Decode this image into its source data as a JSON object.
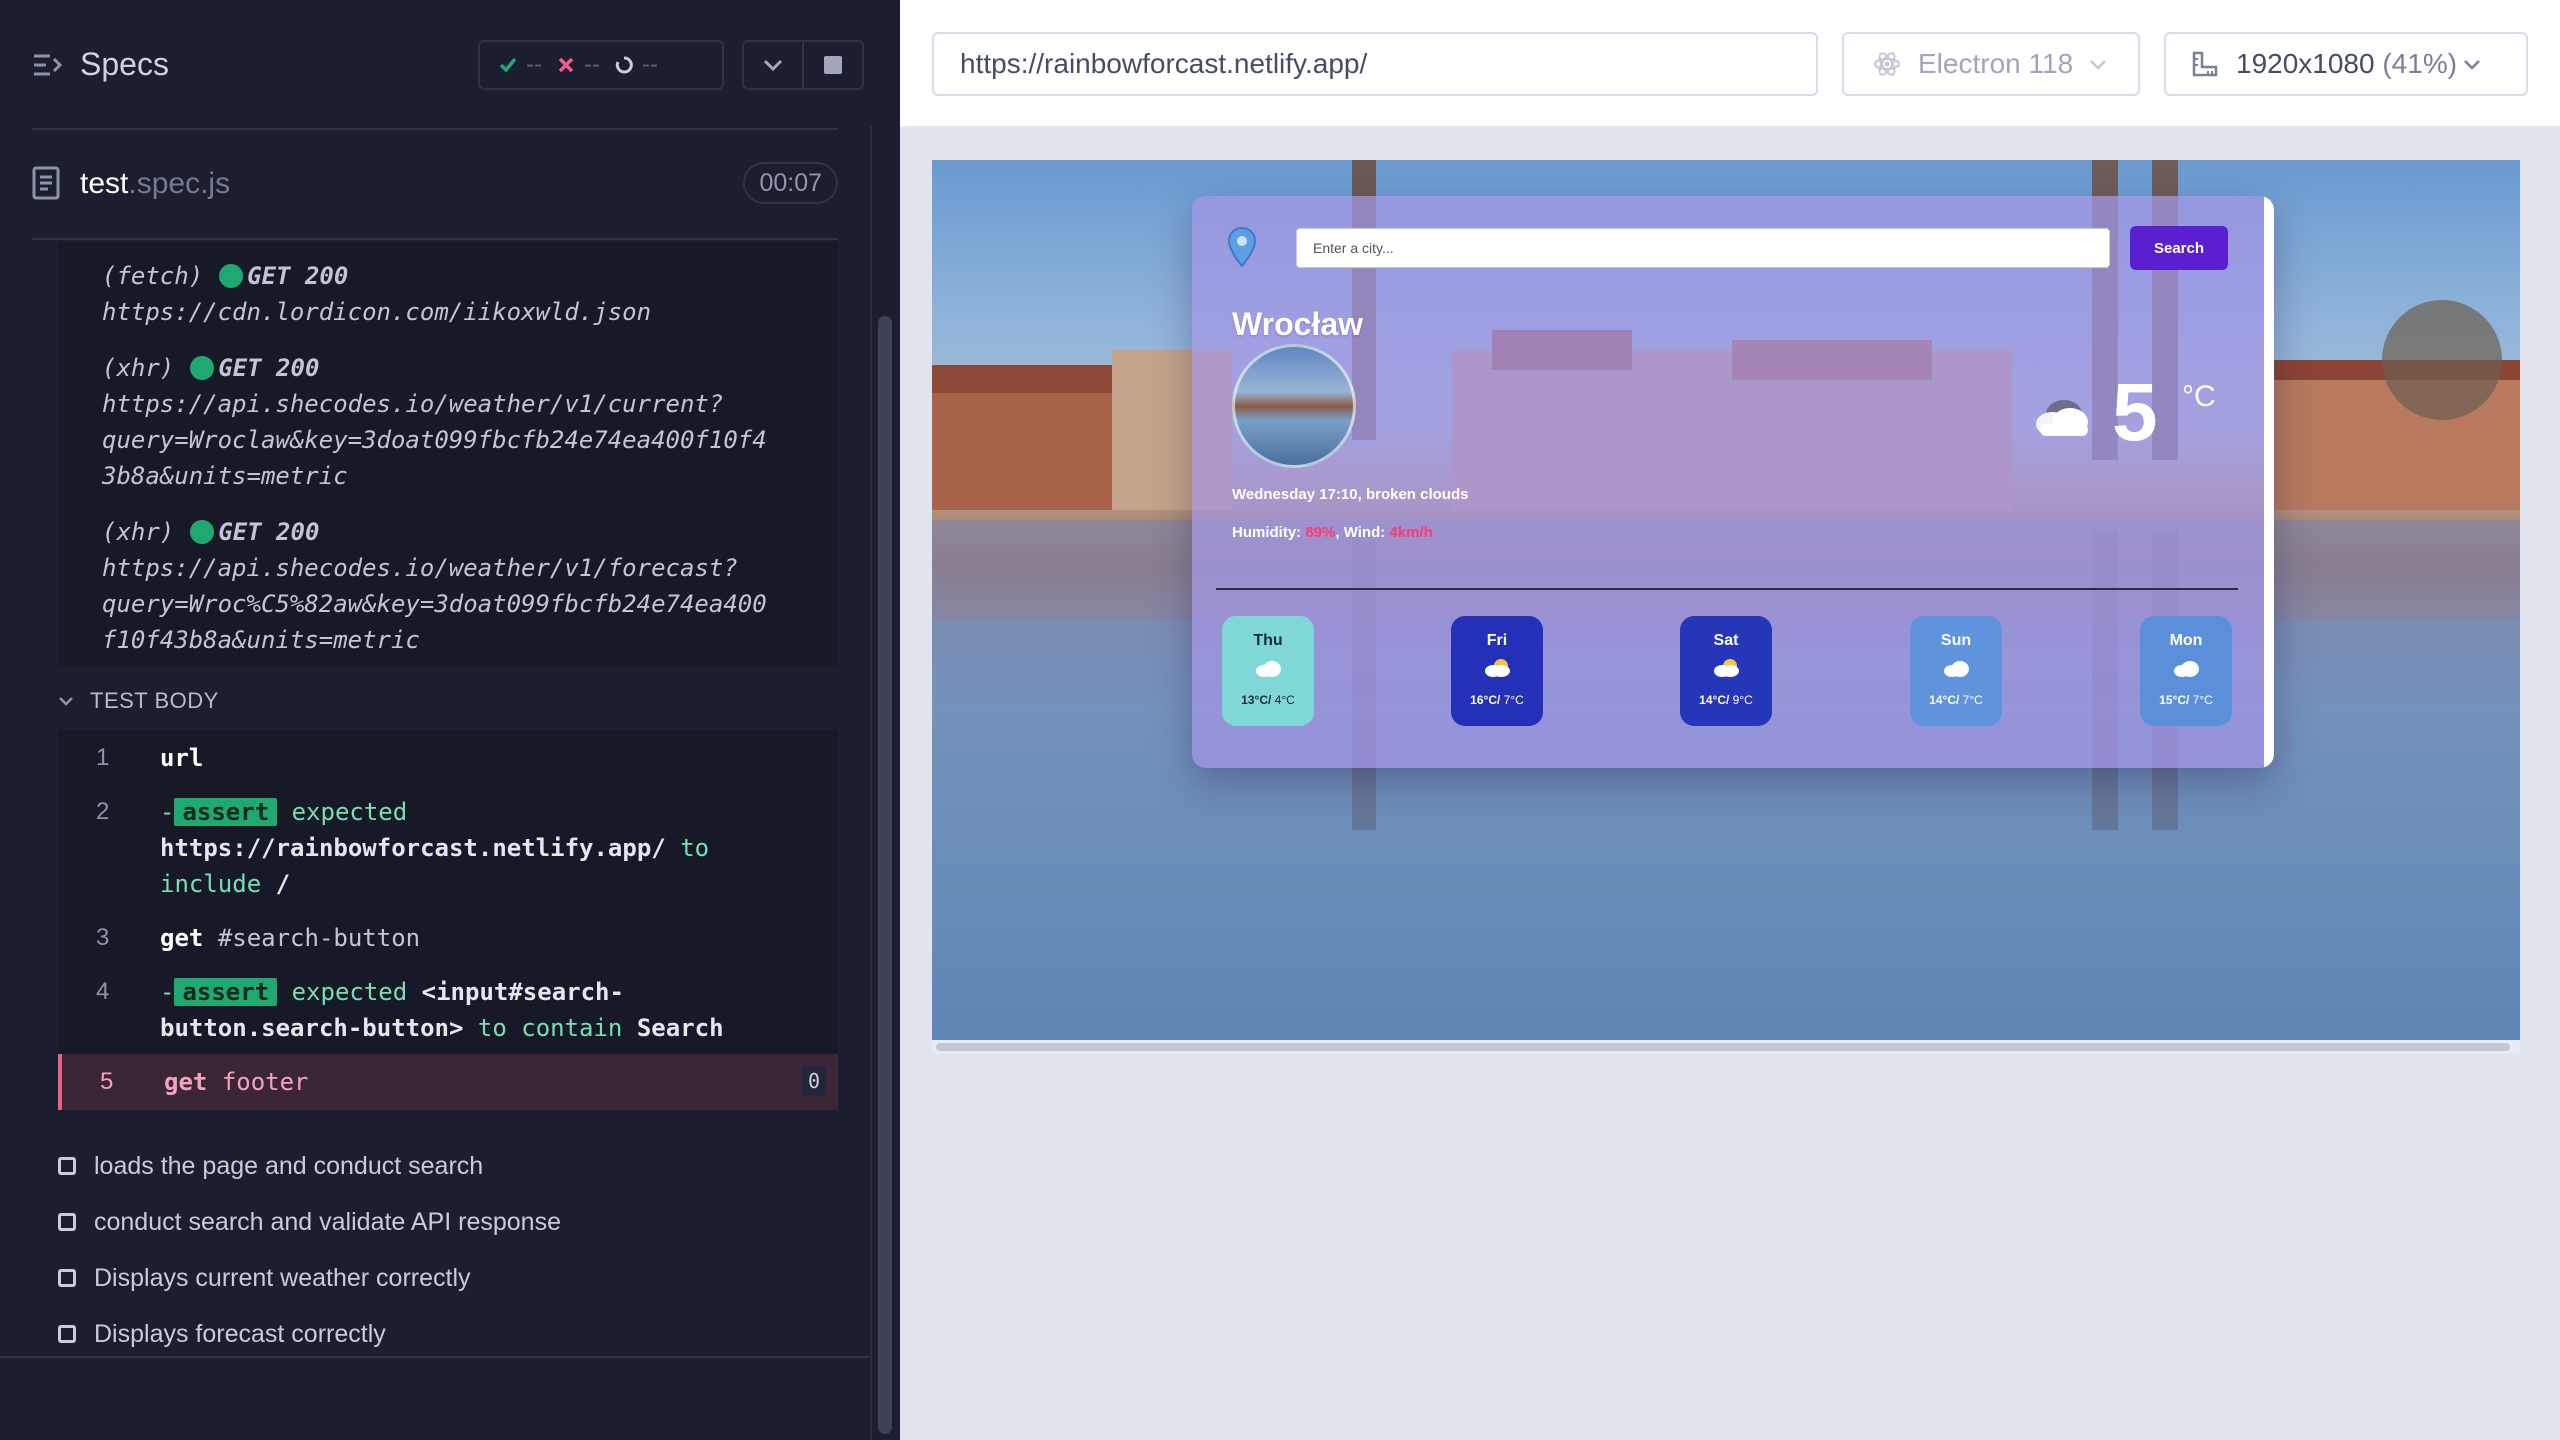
{
  "left_panel": {
    "title": "Specs",
    "stats": {
      "passed": "--",
      "failed": "--",
      "pending": "--"
    },
    "spec_file": {
      "name": "test",
      "ext": ".spec.js",
      "duration": "00:07"
    },
    "requests": [
      {
        "type": "(fetch)",
        "status": "GET 200",
        "url_lines": [
          "https://cdn.lordicon.com/iikoxwld.json"
        ]
      },
      {
        "type": "(xhr)",
        "status": "GET 200",
        "url_lines": [
          "https://api.shecodes.io/weather/v1/current?",
          "query=Wroclaw&key=3doat099fbcfb24e74ea400f10f4",
          "3b8a&units=metric"
        ]
      },
      {
        "type": "(xhr)",
        "status": "GET 200",
        "url_lines": [
          "https://api.shecodes.io/weather/v1/forecast?",
          "query=Wroc%C5%82aw&key=3doat099fbcfb24e74ea400",
          "f10f43b8a&units=metric"
        ]
      }
    ],
    "test_body_label": "TEST BODY",
    "commands": {
      "c1": {
        "num": "1",
        "name": "url"
      },
      "c2": {
        "num": "2",
        "prefix": "-",
        "badge": "assert",
        "expected": "expected",
        "value": "https://rainbowforcast.netlify.app/",
        "to": "to",
        "include": "include",
        "arg": "/"
      },
      "c3": {
        "num": "3",
        "name": "get",
        "arg": "#search-button"
      },
      "c4": {
        "num": "4",
        "prefix": "-",
        "badge": "assert",
        "expected": "expected",
        "value1": "<input#search-",
        "value2": "button.search-button>",
        "to": "to contain",
        "arg": "Search"
      },
      "c5": {
        "num": "5",
        "name": "get",
        "arg": "footer",
        "count": "0"
      }
    },
    "tests": [
      "loads the page and conduct search",
      "conduct search and validate API response",
      "Displays current weather correctly",
      "Displays forecast correctly"
    ]
  },
  "right_panel": {
    "url": "https://rainbowforcast.netlify.app/",
    "browser": "Electron 118",
    "viewport": "1920x1080",
    "viewport_pct": "(41%)"
  },
  "app": {
    "search_placeholder": "Enter a city...",
    "search_button": "Search",
    "city": "Wrocław",
    "description": "Wednesday 17:10, broken clouds",
    "humidity_label": "Humidity:",
    "humidity_value": "89%",
    "wind_label": ", Wind:",
    "wind_value": "4km/h",
    "temperature": "5",
    "unit": "°C",
    "forecast": [
      {
        "day": "Thu",
        "hi": "13°C/",
        "lo": " 4°C",
        "color": "#7fd8d6"
      },
      {
        "day": "Fri",
        "hi": "16°C/",
        "lo": " 7°C",
        "color": "#2430b8"
      },
      {
        "day": "Sat",
        "hi": "14°C/",
        "lo": " 9°C",
        "color": "#2536b8"
      },
      {
        "day": "Sun",
        "hi": "14°C/",
        "lo": " 7°C",
        "color": "#5f93dc"
      },
      {
        "day": "Mon",
        "hi": "15°C/",
        "lo": " 7°C",
        "color": "#5c8fda"
      }
    ]
  },
  "colors": {
    "pass": "#1fa971",
    "fail": "#f05d87",
    "accent": "#5a1fd1"
  }
}
